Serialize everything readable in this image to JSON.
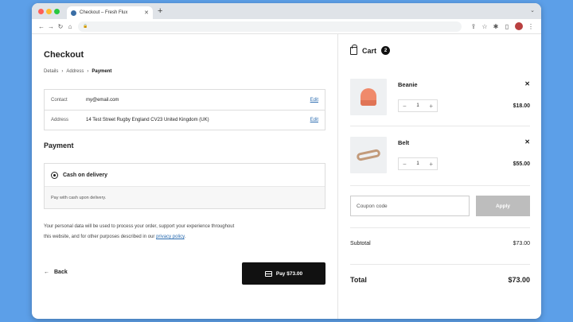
{
  "browser": {
    "tab_title": "Checkout – Fresh Flux",
    "new_tab": "+",
    "lock": "🔒"
  },
  "checkout": {
    "title": "Checkout",
    "breadcrumb": [
      "Details",
      "Address",
      "Payment"
    ],
    "contact_label": "Contact",
    "contact_value": "my@email.com",
    "address_label": "Address",
    "address_value": "14 Test Street Rugby England CV23 United Kingdom (UK)",
    "edit_label": "Edit",
    "payment_title": "Payment",
    "payment_method": "Cash on delivery",
    "payment_desc": "Pay with cash upon delivery.",
    "privacy_text": "Your personal data will be used to process your order, support your experience throughout this website, and for other purposes described in our",
    "privacy_link": "privacy policy",
    "back_label": "Back",
    "pay_label": "Pay $73.00"
  },
  "cart": {
    "title": "Cart",
    "count": "2",
    "items": [
      {
        "name": "Beanie",
        "qty": "1",
        "price": "$18.00"
      },
      {
        "name": "Belt",
        "qty": "1",
        "price": "$55.00"
      }
    ],
    "coupon_placeholder": "Coupon code",
    "apply_label": "Apply",
    "subtotal_label": "Subtotal",
    "subtotal_value": "$73.00",
    "total_label": "Total",
    "total_value": "$73.00"
  }
}
